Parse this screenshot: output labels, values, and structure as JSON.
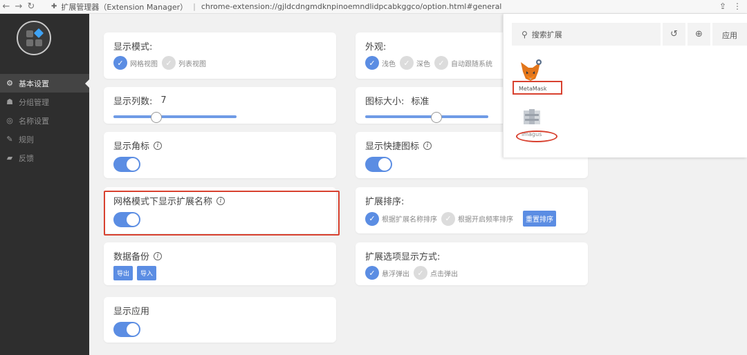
{
  "browser": {
    "tab_title": "扩展管理器（Extension Manager）",
    "url": "chrome-extension://gjldcdngmdknpinoemndlidpcabkggco/option.html#general"
  },
  "sidebar": {
    "items": [
      {
        "label": "基本设置",
        "icon": "gear-icon",
        "active": true
      },
      {
        "label": "分组管理",
        "icon": "hierarchy-icon",
        "active": false
      },
      {
        "label": "名称设置",
        "icon": "compass-icon",
        "active": false
      },
      {
        "label": "规则",
        "icon": "edit-icon",
        "active": false
      },
      {
        "label": "反馈",
        "icon": "chat-icon",
        "active": false
      }
    ]
  },
  "settings": {
    "display_mode": {
      "title": "显示模式:",
      "options": [
        {
          "label": "网格视图",
          "selected": true
        },
        {
          "label": "列表视图",
          "selected": false
        }
      ]
    },
    "appearance": {
      "title": "外观:",
      "options": [
        {
          "label": "浅色",
          "selected": true
        },
        {
          "label": "深色",
          "selected": false
        },
        {
          "label": "自动跟随系统",
          "selected": false
        }
      ]
    },
    "columns": {
      "title": "显示列数:",
      "value": "7",
      "level": 0.35
    },
    "icon_size": {
      "title": "图标大小:",
      "value": "标准",
      "level": 0.5
    },
    "show_badge": {
      "title": "显示角标",
      "on": true
    },
    "show_shortcut_icon": {
      "title": "显示快捷图标",
      "on": true
    },
    "show_ext_name": {
      "title": "网格模式下显示扩展名称",
      "on": true
    },
    "sort": {
      "title": "扩展排序:",
      "options": [
        {
          "label": "根据扩展名称排序",
          "selected": true
        },
        {
          "label": "根据开启频率排序",
          "selected": false
        }
      ],
      "reset_label": "重置排序"
    },
    "backup": {
      "title": "数据备份",
      "export_label": "导出",
      "import_label": "导入"
    },
    "option_display": {
      "title": "扩展选项显示方式:",
      "options": [
        {
          "label": "悬浮弹出",
          "selected": true
        },
        {
          "label": "点击弹出",
          "selected": false
        }
      ]
    },
    "show_apps": {
      "title": "显示应用",
      "on": true
    }
  },
  "popup": {
    "search_placeholder": "搜索扩展",
    "apps_label": "应用",
    "extensions": [
      {
        "name": "MetaMask"
      },
      {
        "name": "Imagus"
      }
    ]
  },
  "colors": {
    "accent": "#5b8de3",
    "sidebar_bg": "#2e2e2e",
    "highlight": "#d8412f"
  }
}
